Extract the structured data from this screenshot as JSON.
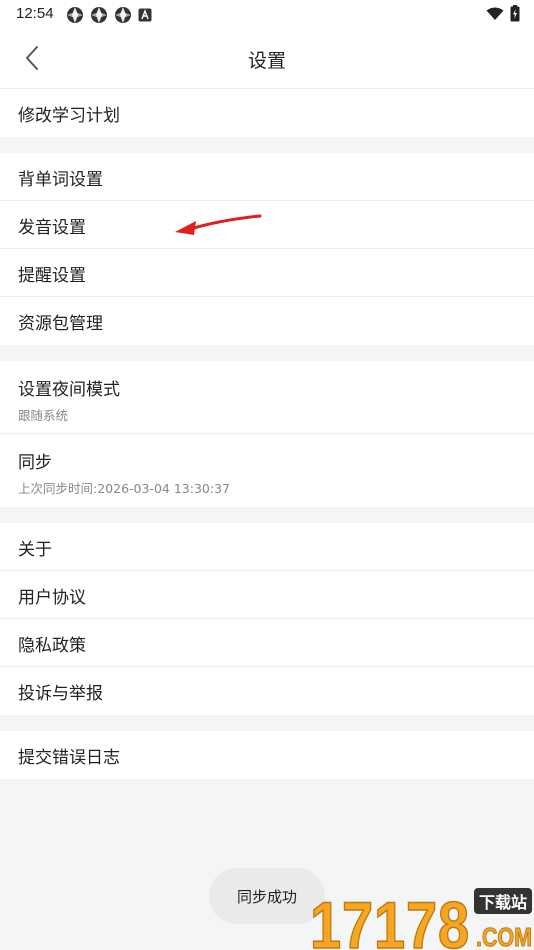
{
  "status_bar": {
    "time": "12:54",
    "left_icons": [
      "aperture-icon",
      "aperture-icon",
      "aperture-icon",
      "a-box-icon"
    ],
    "right_icons": [
      "wifi-icon",
      "battery-charging-icon"
    ]
  },
  "header": {
    "title": "设置",
    "back_icon": "chevron-left-icon"
  },
  "groups": [
    {
      "items": [
        {
          "label": "修改学习计划"
        }
      ]
    },
    {
      "items": [
        {
          "label": "背单词设置"
        },
        {
          "label": "发音设置"
        },
        {
          "label": "提醒设置"
        },
        {
          "label": "资源包管理"
        }
      ]
    },
    {
      "items": [
        {
          "label": "设置夜间模式",
          "sub": "跟随系统"
        },
        {
          "label": "同步",
          "sub": "上次同步时间:2026-03-04 13:30:37"
        }
      ]
    },
    {
      "items": [
        {
          "label": "关于"
        },
        {
          "label": "用户协议"
        },
        {
          "label": "隐私政策"
        },
        {
          "label": "投诉与举报"
        }
      ]
    },
    {
      "items": [
        {
          "label": "提交错误日志"
        }
      ]
    }
  ],
  "toast": {
    "text": "同步成功"
  },
  "watermark": {
    "number": "17178",
    "tag": "下载站",
    "domain": ".COM"
  },
  "colors": {
    "background": "#f4f5f7",
    "card": "#ffffff",
    "annotation_arrow": "#e02020",
    "watermark_orange": "#f5a623"
  }
}
